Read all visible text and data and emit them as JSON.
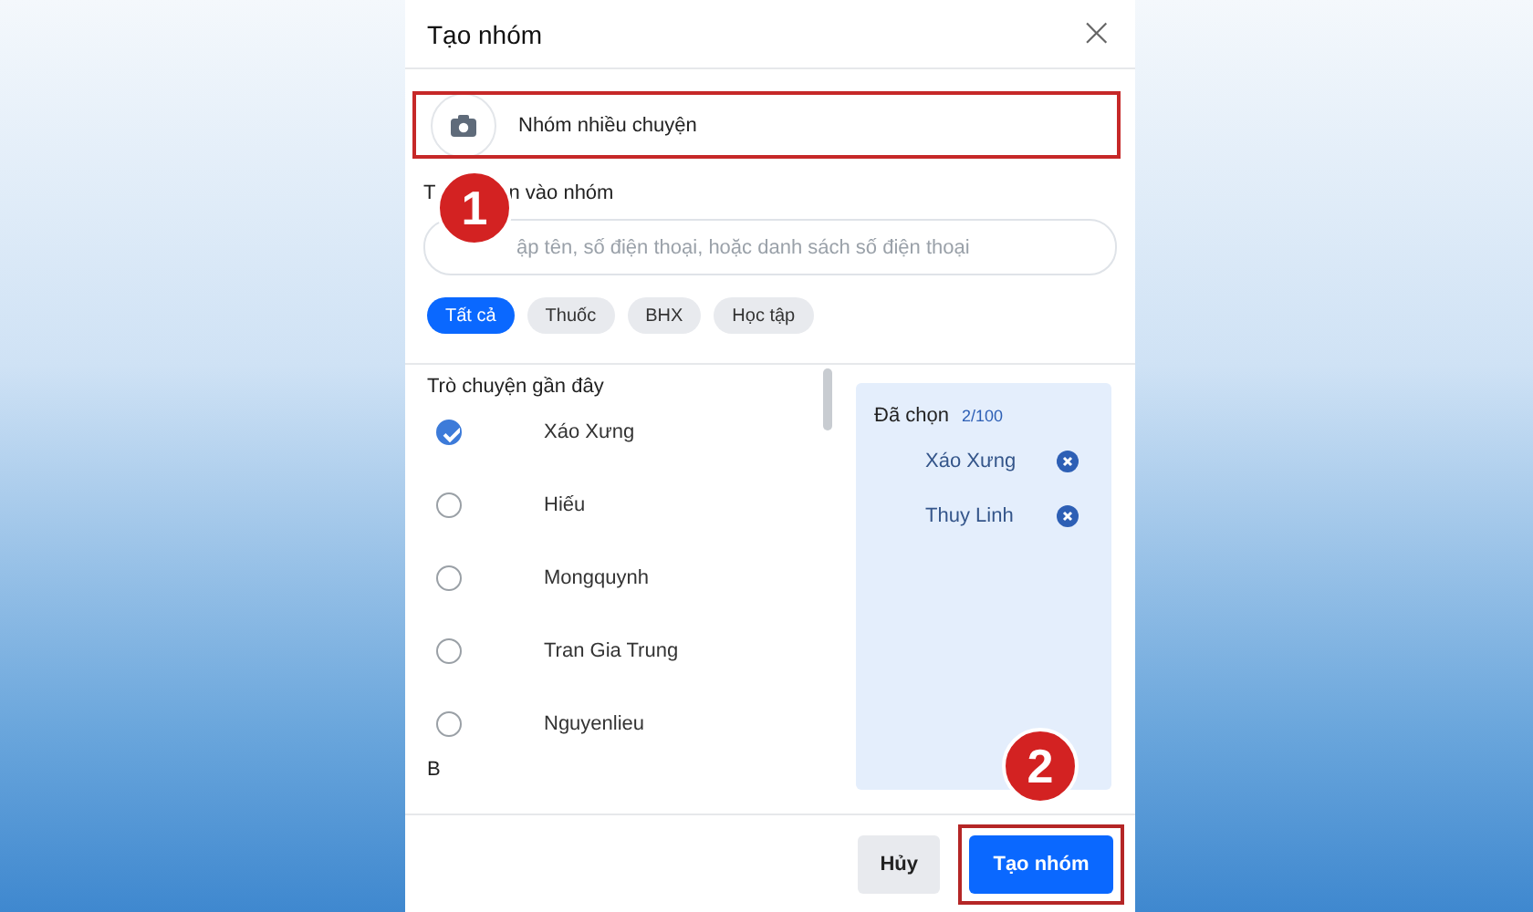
{
  "dialog": {
    "title": "Tạo nhóm",
    "close": "×"
  },
  "group_name": {
    "value": "Nhóm nhiều chuyện",
    "highlighted": true
  },
  "add_label_parts": [
    "T",
    "n vào nhóm"
  ],
  "search": {
    "placeholder": "ập tên, số điện thoại, hoặc danh sách số điện thoại"
  },
  "filters": [
    {
      "label": "Tất cả",
      "selected": true
    },
    {
      "label": "Thuốc",
      "selected": false
    },
    {
      "label": "BHX",
      "selected": false
    },
    {
      "label": "Học tập",
      "selected": false
    }
  ],
  "recent": {
    "heading": "Trò chuyện gần đây",
    "contacts": [
      {
        "name": "Xáo Xưng",
        "checked": true
      },
      {
        "name": "Hiếu",
        "checked": false
      },
      {
        "name": "Mongquynh",
        "checked": false
      },
      {
        "name": "Tran Gia Trung",
        "checked": false
      },
      {
        "name": "Nguyenlieu",
        "checked": false
      }
    ],
    "next_section": "B"
  },
  "selected_panel": {
    "title": "Đã chọn",
    "count": "2/100",
    "items": [
      {
        "name": "Xáo Xưng"
      },
      {
        "name": "Thuy Linh"
      }
    ]
  },
  "buttons": [
    {
      "label": "Hủy",
      "kind": "secondary",
      "highlighted": false
    },
    {
      "label": "Tạo nhóm",
      "kind": "primary",
      "highlighted": true
    }
  ],
  "step_badges": [
    {
      "text": "1",
      "kind": "name"
    },
    {
      "text": "2",
      "kind": "submit"
    }
  ]
}
